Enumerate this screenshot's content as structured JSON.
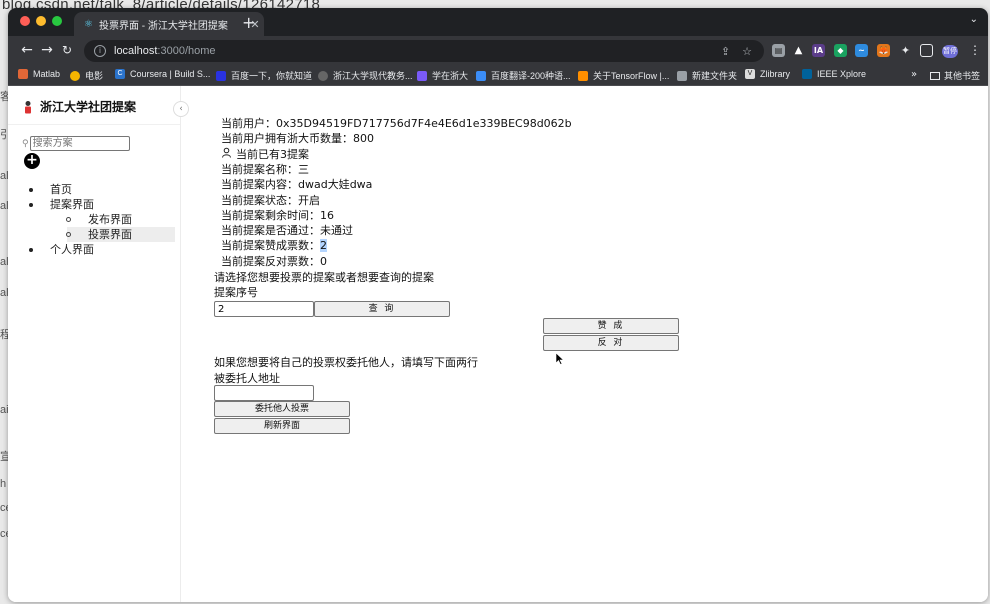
{
  "background": {
    "url_fragment": "blog.csdn.net/talk_8/article/details/126142718",
    "edge_letters": [
      "客",
      "引",
      "al",
      "al",
      "al",
      "al",
      "程",
      "ai",
      "宣",
      "h",
      "ce",
      "ce"
    ]
  },
  "browser": {
    "tab_title": "投票界面 - 浙江大学社团提案",
    "url_host": "localhost",
    "url_path": ":3000/home",
    "profile_label": "暂停",
    "bookmarks": [
      {
        "label": "Matlab",
        "icon": "matlab-icon",
        "color": "#e16737"
      },
      {
        "label": "电影",
        "icon": "movie-icon",
        "color": "#f5b400"
      },
      {
        "label": "Coursera | Build S...",
        "icon": "coursera-icon",
        "color": "#2a73cc"
      },
      {
        "label": "百度一下，你就知道",
        "icon": "baidu-icon",
        "color": "#2932e1"
      },
      {
        "label": "浙江大学现代教务...",
        "icon": "globe-icon",
        "color": "#666666"
      },
      {
        "label": "学在浙大",
        "icon": "zju-icon",
        "color": "#7a5af8"
      },
      {
        "label": "百度翻译-200种语...",
        "icon": "translate-icon",
        "color": "#3b8df7"
      },
      {
        "label": "关于TensorFlow |...",
        "icon": "tensorflow-icon",
        "color": "#ff8f00"
      },
      {
        "label": "新建文件夹",
        "icon": "folder-icon",
        "color": "#9aa0a6"
      },
      {
        "label": "Zlibrary",
        "icon": "zlibrary-icon",
        "color": "#dddddd"
      },
      {
        "label": "IEEE Xplore",
        "icon": "ieee-icon",
        "color": "#00629b"
      }
    ],
    "other_bookmarks": "其他书签"
  },
  "sidebar": {
    "logo_text": "浙江大学社团提案",
    "search_placeholder": "搜索方案",
    "menu": [
      {
        "label": "首页"
      },
      {
        "label": "提案界面",
        "children": [
          {
            "label": "发布界面"
          },
          {
            "label": "投票界面",
            "selected": true
          }
        ]
      },
      {
        "label": "个人界面"
      }
    ]
  },
  "main": {
    "current_user_label": "当前用户：",
    "current_user_value": "0x35D94519FD717756d7F4e4E6d1e339BEC98d062b",
    "balance_label": "当前用户拥有浙大币数量：",
    "balance_value": "800",
    "proposal_count_text": "当前已有3提案",
    "name_label": "当前提案名称：",
    "name_value": "三",
    "content_label": "当前提案内容：",
    "content_value": "dwad大娃dwa",
    "status_label": "当前提案状态：",
    "status_value": "开启",
    "time_label": "当前提案剩余时间：",
    "time_value": "16",
    "passed_label": "当前提案是否通过：",
    "passed_value": "未通过",
    "yes_label": "当前提案赞成票数：",
    "yes_value": "2",
    "no_label": "当前提案反对票数：",
    "no_value": "0",
    "select_prompt": "请选择您想要投票的提案或者想要查询的提案",
    "index_label": "提案序号",
    "index_value": "2",
    "query_button": "查 询",
    "approve_button": "赞 成",
    "oppose_button": "反 对",
    "delegate_prompt": "如果您想要将自己的投票权委托他人，请填写下面两行",
    "delegate_label": "被委托人地址",
    "delegate_value": "",
    "delegate_button": "委托他人投票",
    "refresh_button": "刷新界面"
  }
}
